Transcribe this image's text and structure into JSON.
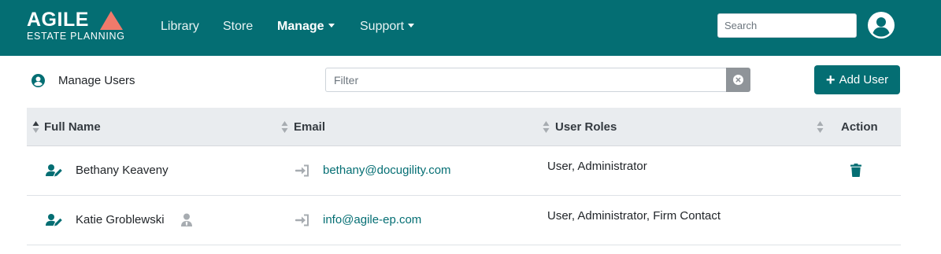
{
  "navbar": {
    "logo_main": "AGILE",
    "logo_sub": "ESTATE PLANNING",
    "links": [
      {
        "label": "Library"
      },
      {
        "label": "Store"
      },
      {
        "label": "Manage"
      },
      {
        "label": "Support"
      }
    ],
    "search_placeholder": "Search"
  },
  "toolbar": {
    "title": "Manage Users",
    "filter_placeholder": "Filter",
    "add_user_label": "Add User"
  },
  "table": {
    "headers": [
      "Full Name",
      "Email",
      "User Roles",
      "Action"
    ],
    "rows": [
      {
        "name": "Bethany Keaveny",
        "email": "bethany@docugility.com",
        "roles": "User, Administrator"
      },
      {
        "name": "Katie Groblewski",
        "email": "info@agile-ep.com",
        "roles": "User, Administrator, Firm Contact"
      }
    ]
  },
  "colors": {
    "brand_teal": "#046e73",
    "logo_accent": "#f07a6b",
    "header_bg": "#e9ecef"
  },
  "icons": {
    "avatar": "user-circle-icon",
    "manage_users": "user-circle-icon",
    "clear": "times-circle-icon",
    "edit_user": "user-edit-icon",
    "impersonate": "sign-in-icon",
    "delete": "trash-icon",
    "contact": "user-tie-icon"
  }
}
